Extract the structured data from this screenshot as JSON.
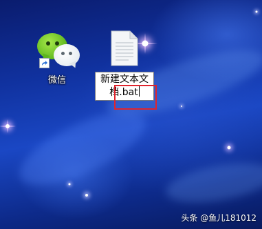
{
  "desktop": {
    "icons": [
      {
        "label": "微信",
        "icon": "wechat-icon",
        "shortcut": true
      },
      {
        "label": "新建文本文档.bat",
        "icon": "text-file-icon",
        "renaming": true
      }
    ],
    "rename": {
      "line1": "新建文本文",
      "line2": "档.bat"
    }
  },
  "watermark": "头条 @鱼儿181012",
  "colors": {
    "highlight": "#e0242d",
    "wallpaper": "#1a47c4"
  }
}
